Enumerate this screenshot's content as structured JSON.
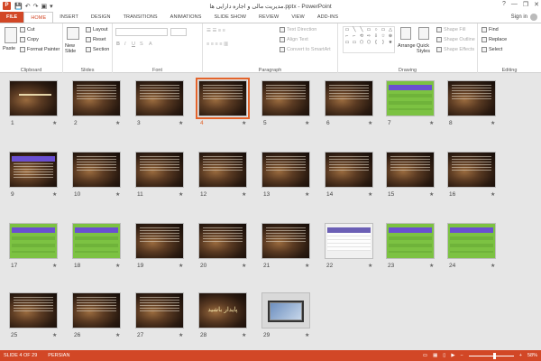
{
  "window": {
    "title": "مدیریت مالی و اجاره دارایی ها.pptx - PowerPoint",
    "app_icon_letter": "P",
    "controls": [
      "?",
      "—",
      "❐",
      "✕"
    ]
  },
  "qat": [
    "💾",
    "↶",
    "↷",
    "▣",
    "▾"
  ],
  "tabs": [
    "FILE",
    "HOME",
    "INSERT",
    "DESIGN",
    "TRANSITIONS",
    "ANIMATIONS",
    "SLIDE SHOW",
    "REVIEW",
    "VIEW",
    "ADD-INS"
  ],
  "active_tab": "HOME",
  "signin": "Sign in",
  "ribbon": {
    "clipboard": {
      "label": "Clipboard",
      "paste": "Paste",
      "cut": "Cut",
      "copy": "Copy",
      "format_painter": "Format Painter"
    },
    "slides": {
      "label": "Slides",
      "new_slide": "New Slide",
      "layout": "Layout",
      "reset": "Reset",
      "section": "Section"
    },
    "font": {
      "label": "Font"
    },
    "paragraph": {
      "label": "Paragraph",
      "text_direction": "Text Direction",
      "align_text": "Align Text",
      "convert": "Convert to SmartArt"
    },
    "drawing": {
      "label": "Drawing",
      "arrange": "Arrange",
      "quick_styles": "Quick Styles",
      "shape_fill": "Shape Fill",
      "shape_outline": "Shape Outline",
      "shape_effects": "Shape Effects"
    },
    "editing": {
      "label": "Editing",
      "find": "Find",
      "replace": "Replace",
      "select": "Select"
    }
  },
  "slides": [
    {
      "n": "1",
      "kind": "title"
    },
    {
      "n": "2",
      "kind": "text"
    },
    {
      "n": "3",
      "kind": "text"
    },
    {
      "n": "4",
      "kind": "text",
      "selected": true
    },
    {
      "n": "5",
      "kind": "text"
    },
    {
      "n": "6",
      "kind": "text"
    },
    {
      "n": "7",
      "kind": "table-green"
    },
    {
      "n": "8",
      "kind": "text"
    },
    {
      "n": "9",
      "kind": "table-purple"
    },
    {
      "n": "10",
      "kind": "text"
    },
    {
      "n": "11",
      "kind": "text"
    },
    {
      "n": "12",
      "kind": "text"
    },
    {
      "n": "13",
      "kind": "text"
    },
    {
      "n": "14",
      "kind": "text"
    },
    {
      "n": "15",
      "kind": "text"
    },
    {
      "n": "16",
      "kind": "text"
    },
    {
      "n": "17",
      "kind": "table-green"
    },
    {
      "n": "18",
      "kind": "table-green"
    },
    {
      "n": "19",
      "kind": "text"
    },
    {
      "n": "20",
      "kind": "text"
    },
    {
      "n": "21",
      "kind": "text"
    },
    {
      "n": "22",
      "kind": "table-white"
    },
    {
      "n": "23",
      "kind": "table-green"
    },
    {
      "n": "24",
      "kind": "table-green"
    },
    {
      "n": "25",
      "kind": "text"
    },
    {
      "n": "26",
      "kind": "text"
    },
    {
      "n": "27",
      "kind": "text"
    },
    {
      "n": "28",
      "kind": "closing",
      "label": "پایدار باشید"
    },
    {
      "n": "29",
      "kind": "photo"
    }
  ],
  "status": {
    "slide_info": "SLIDE 4 OF 29",
    "language": "PERSIAN",
    "zoom": "58%",
    "zoom_fraction": 0.58
  },
  "colors": {
    "accent": "#d24726",
    "selection": "#e3632a",
    "sorter_bg": "#e6e6e6"
  }
}
